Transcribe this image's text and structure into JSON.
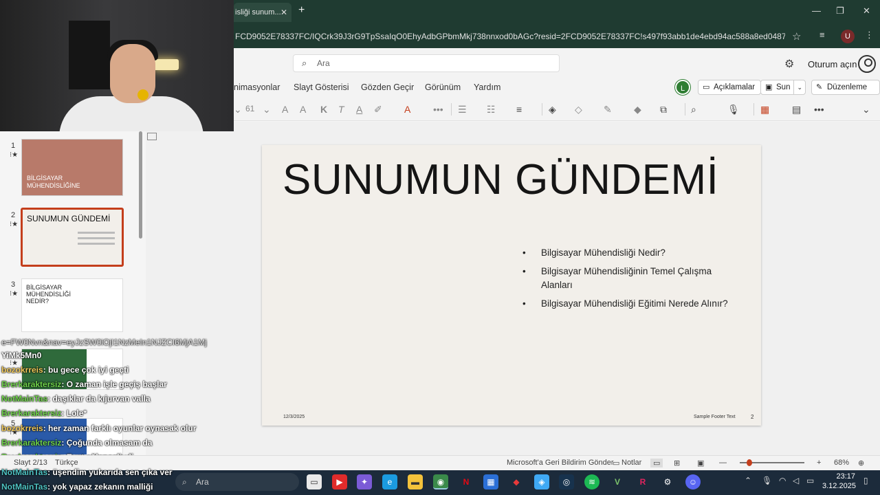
{
  "browser": {
    "tab_title": "isliği sunum...",
    "url": "FCD9052E78337FC/IQCrk39J3rG9TpSsaIqO0EhyAdbGPbmMkj738nnxod0bAGc?resid=2FCD9052E78337FC!s497f93abb1de4ebd94ac588a8ed04872&ithi...",
    "avatar_letter": "U"
  },
  "office": {
    "search_placeholder": "Ara",
    "signin_label": "Oturum açın",
    "ribbon_tabs": [
      "nimasyonlar",
      "Slayt Gösterisi",
      "Gözden Geçir",
      "Görünüm",
      "Yardım"
    ],
    "collab_initial": "L",
    "comments_label": "Açıklamalar",
    "present_label": "Sun",
    "editing_label": "Düzenleme",
    "font_size": "61"
  },
  "slide": {
    "title": "SUNUMUN GÜNDEMİ",
    "bullets": [
      "Bilgisayar Mühendisliği Nedir?",
      "Bilgisayar Mühendisliğinin Temel Çalışma Alanları",
      "Bilgisayar Mühendisliği Eğitimi Nerede Alınır?"
    ],
    "date": "12/3/2025",
    "footer": "Sample Footer Text",
    "number": "2"
  },
  "thumbnails": [
    {
      "num": "1",
      "title": "BİLGİSAYAR MÜHENDİSLİĞİNE"
    },
    {
      "num": "2",
      "title": "SUNUMUN GÜNDEMİ"
    },
    {
      "num": "3",
      "title": "BİLGİSAYAR MÜHENDİSLİĞİ NEDİR?"
    },
    {
      "num": "4",
      "title": ""
    },
    {
      "num": "5",
      "title": ""
    }
  ],
  "chat": [
    {
      "user": "",
      "text": "e=FW0Nvn&nav=eyJzSW0iOjI1NzMeIn1NJZCI6MjA1Mj"
    },
    {
      "user": "",
      "text": "YiMk5Mn0"
    },
    {
      "user": "bozokrreis",
      "text": ": bu gece çok iyi geçti"
    },
    {
      "user": "Brerkaraktersiz",
      "text": ": O zaman işle geçiş başlar"
    },
    {
      "user": "NotMainTas",
      "text": ": daşıklar da kıjurvan valla"
    },
    {
      "user": "Brerkaraktersiz",
      "text": ": Lole*"
    },
    {
      "user": "bozokrreis",
      "text": ": her zaman farklı oyunlar oynasak olur"
    },
    {
      "user": "Brerkaraktersiz",
      "text": ": Çoğunda olmasam da"
    },
    {
      "user": "Brerkaraktersiz",
      "text": ": Evet eğlenceliydi"
    },
    {
      "user": "NotMainTas",
      "text": ": üşendim yukarıda sen çıka ver"
    },
    {
      "user": "NotMainTas",
      "text": ": yok yapaz zekanın malliği"
    }
  ],
  "statusbar": {
    "slide_info": "Slayt 2/13",
    "language": "Türkçe",
    "feedback": "Microsoft'a Geri Bildirim Gönder",
    "notes": "Notlar",
    "zoom": "68%",
    "zoom_level": 0.68
  },
  "taskbar": {
    "search_placeholder": "Ara",
    "time": "23:17",
    "date": "3.12.2025"
  }
}
